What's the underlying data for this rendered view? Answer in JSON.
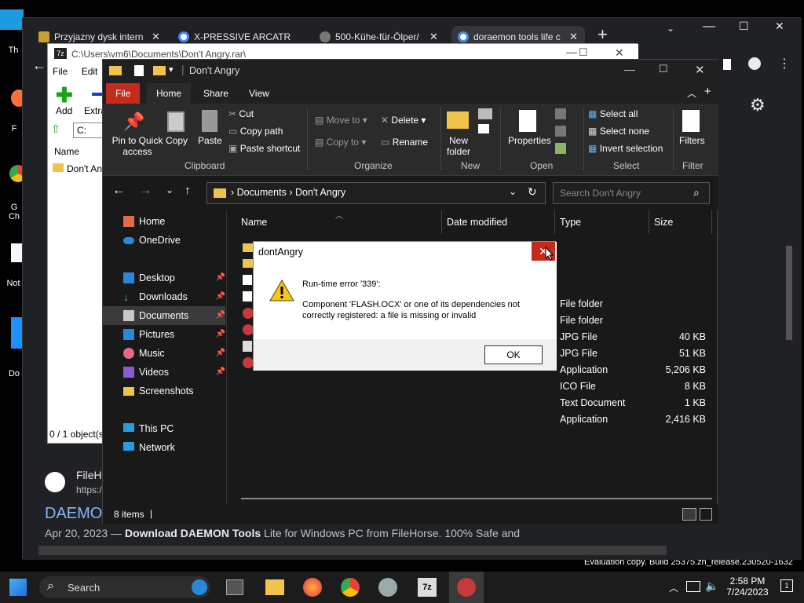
{
  "desktop": {
    "icons": [
      {
        "label": "Th"
      },
      {
        "label": "F"
      },
      {
        "label": "G Ch"
      },
      {
        "label": "Not"
      },
      {
        "label": "Do"
      }
    ],
    "watermark": "Evaluation copy. Build 25375.zn_release.230520-1632"
  },
  "chrome": {
    "tabs": [
      {
        "title": "Przyjazny dysk intern"
      },
      {
        "title": "X-PRESSIVE ARCATR"
      },
      {
        "title": "500-Kühe-für-Ölper/"
      },
      {
        "title": "doraemon tools life c"
      }
    ],
    "page": {
      "site_name": "FileHo",
      "site_url": "https:/",
      "headline": "DAEMON",
      "snippet_date": "Apr 20, 2023 —",
      "snippet_bold": "Download DAEMON Tools",
      "snippet_rest": "Lite for Windows PC from FileHorse. 100% Safe and"
    }
  },
  "sevenzip": {
    "title": "C:\\Users\\vm6\\Documents\\Don't Angry.rar\\",
    "menu": [
      "File",
      "Edit"
    ],
    "toolbar": {
      "add": "Add",
      "extract": "Extra"
    },
    "path_partial": "C:",
    "column_name": "Name",
    "row": "Don't An",
    "status": "0 / 1 object(s"
  },
  "explorer": {
    "title": "Don't Angry",
    "ribbon_tabs": [
      "File",
      "Home",
      "Share",
      "View"
    ],
    "clipboard": {
      "pin": "Pin to Quick",
      "pin2": "access",
      "copy": "Copy",
      "paste": "Paste",
      "cut": "Cut",
      "copy_path": "Copy path",
      "paste_shortcut": "Paste shortcut",
      "group": "Clipboard"
    },
    "organize": {
      "move_to": "Move to",
      "copy_to": "Copy to",
      "delete": "Delete",
      "rename": "Rename",
      "group": "Organize"
    },
    "new": {
      "new_folder": "New",
      "new_folder2": "folder",
      "group": "New"
    },
    "open": {
      "properties": "Properties",
      "group": "Open"
    },
    "select": {
      "select_all": "Select all",
      "select_none": "Select none",
      "invert": "Invert selection",
      "group": "Select"
    },
    "filter": {
      "filters": "Filters",
      "group": "Filter"
    },
    "breadcrumb": [
      "Documents",
      "Don't Angry"
    ],
    "search_placeholder": "Search Don't Angry",
    "nav": [
      {
        "label": "Home",
        "pinned": false
      },
      {
        "label": "OneDrive",
        "pinned": false
      },
      {
        "label": "Desktop",
        "pinned": true
      },
      {
        "label": "Downloads",
        "pinned": true
      },
      {
        "label": "Documents",
        "pinned": true
      },
      {
        "label": "Pictures",
        "pinned": true
      },
      {
        "label": "Music",
        "pinned": true
      },
      {
        "label": "Videos",
        "pinned": true
      },
      {
        "label": "Screenshots",
        "pinned": false
      },
      {
        "label": "This PC",
        "pinned": false
      },
      {
        "label": "Network",
        "pinned": false
      }
    ],
    "columns": [
      "Name",
      "Date modified",
      "Type",
      "Size"
    ],
    "files": [
      {
        "type": "File folder",
        "size": ""
      },
      {
        "type": "File folder",
        "size": ""
      },
      {
        "type": "JPG File",
        "size": "40 KB"
      },
      {
        "type": "JPG File",
        "size": "51 KB"
      },
      {
        "type": "Application",
        "size": "5,206 KB"
      },
      {
        "type": "ICO File",
        "size": "8 KB"
      },
      {
        "type": "Text Document",
        "size": "1 KB"
      },
      {
        "type": "Application",
        "size": "2,416 KB"
      }
    ],
    "status": "8 items"
  },
  "dialog": {
    "title": "dontAngry",
    "heading": "Run-time error '339':",
    "message_line1": "Component 'FLASH.OCX' or one of its dependencies not",
    "message_line2": "correctly registered: a file is missing or invalid",
    "ok": "OK"
  },
  "taskbar": {
    "search": "Search",
    "time": "2:58 PM",
    "date": "7/24/2023",
    "notifications": "1"
  },
  "colors": {
    "file_tab": "#c42b1c",
    "chrome_bg": "#202124",
    "explorer_bg": "#191919",
    "link_blue": "#8ab4f8",
    "close_red": "#c42b1c"
  }
}
